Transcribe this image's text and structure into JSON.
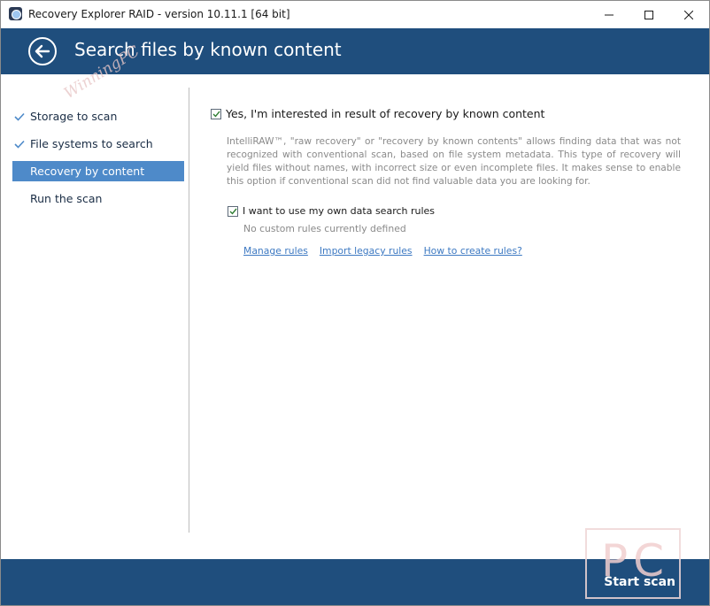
{
  "window": {
    "title": "Recovery Explorer RAID - version 10.11.1 [64 bit]",
    "icon": "recovery-explorer-app-icon"
  },
  "header": {
    "title": "Search files by known content",
    "back_icon": "arrow-left-circle-icon",
    "background_color": "#1f4e7d"
  },
  "sidebar": {
    "items": [
      {
        "label": "Storage to scan",
        "state": "done",
        "icon": "checkmark-icon"
      },
      {
        "label": "File systems to search",
        "state": "done",
        "icon": "checkmark-icon"
      },
      {
        "label": "Recovery by content",
        "state": "active"
      },
      {
        "label": "Run the scan",
        "state": "pending"
      }
    ],
    "active_color": "#4e8ac9"
  },
  "main": {
    "recovery_by_content": {
      "label": "Yes, I'm interested in result of recovery by known content",
      "checked": true
    },
    "description": "IntelliRAW™, \"raw recovery\" or \"recovery by known contents\" allows finding data that was not recognized with conventional scan, based on file system metadata. This type of recovery will yield files without names, with incorrect size or even incomplete files. It makes sense to enable this option if conventional scan did not find valuable data you are looking for.",
    "own_rules": {
      "label": "I want to use my own data search rules",
      "checked": true
    },
    "no_rules_text": "No custom rules currently defined",
    "links": {
      "manage": "Manage rules",
      "import": "Import legacy rules",
      "howto": "How to create rules?"
    }
  },
  "footer": {
    "start_label": "Start scan"
  },
  "watermark": {
    "text": "WinningPC",
    "stamp": "PC"
  }
}
